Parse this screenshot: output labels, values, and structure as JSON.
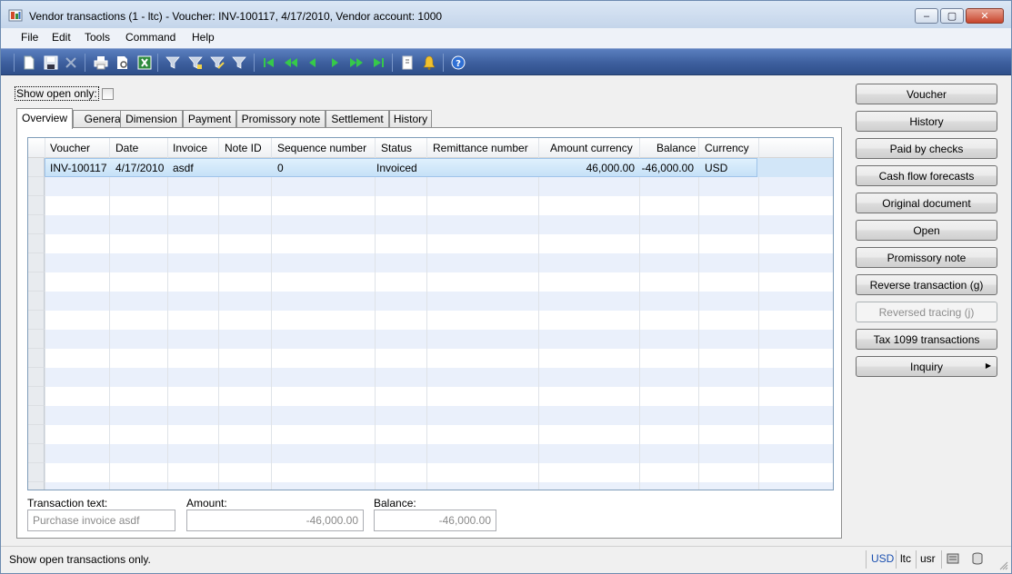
{
  "window": {
    "title": "Vendor transactions (1 - ltc) - Voucher: INV-100117, 4/17/2010, Vendor account: 1000",
    "app_icon": "dynamics-ax-icon"
  },
  "menu": [
    "File",
    "Edit",
    "Tools",
    "Command",
    "Help"
  ],
  "toolbar_icons": [
    "new-icon",
    "save-icon",
    "delete-icon",
    "print-icon",
    "print-preview-icon",
    "export-excel-icon",
    "filter-by-field-icon",
    "filter-by-selection-icon",
    "filter-advanced-icon",
    "remove-filter-icon",
    "first-record-icon",
    "previous-page-icon",
    "previous-record-icon",
    "next-record-icon",
    "next-page-icon",
    "last-record-icon",
    "attachments-icon",
    "alert-icon",
    "help-icon"
  ],
  "filter": {
    "show_open_only_label": "Show open only:"
  },
  "tabs": [
    "Overview",
    "General",
    "Dimension",
    "Payment",
    "Promissory note",
    "Settlement",
    "History"
  ],
  "grid": {
    "columns": [
      "Voucher",
      "Date",
      "Invoice",
      "Note ID",
      "Sequence number",
      "Status",
      "Remittance number",
      "Amount currency",
      "Balance",
      "Currency"
    ],
    "rows": [
      {
        "voucher": "INV-100117",
        "date": "4/17/2010",
        "invoice": "asdf",
        "note_id": "",
        "sequence_number": "0",
        "status": "Invoiced",
        "remittance_number": "",
        "amount_currency": "46,000.00",
        "balance": "-46,000.00",
        "currency": "USD"
      }
    ]
  },
  "fields": {
    "transaction_text_label": "Transaction text:",
    "transaction_text_value": "Purchase invoice asdf",
    "amount_label": "Amount:",
    "amount_value": "-46,000.00",
    "balance_label": "Balance:",
    "balance_value": "-46,000.00"
  },
  "buttons": [
    "Voucher",
    "History",
    "Paid by checks",
    "Cash flow forecasts",
    "Original document",
    "Open",
    "Promissory note",
    "Reverse transaction (g)",
    "Reversed tracing (j)",
    "Tax 1099 transactions",
    "Inquiry"
  ],
  "status": {
    "text": "Show open transactions only.",
    "currency": "USD",
    "company": "ltc",
    "layer": "usr"
  }
}
